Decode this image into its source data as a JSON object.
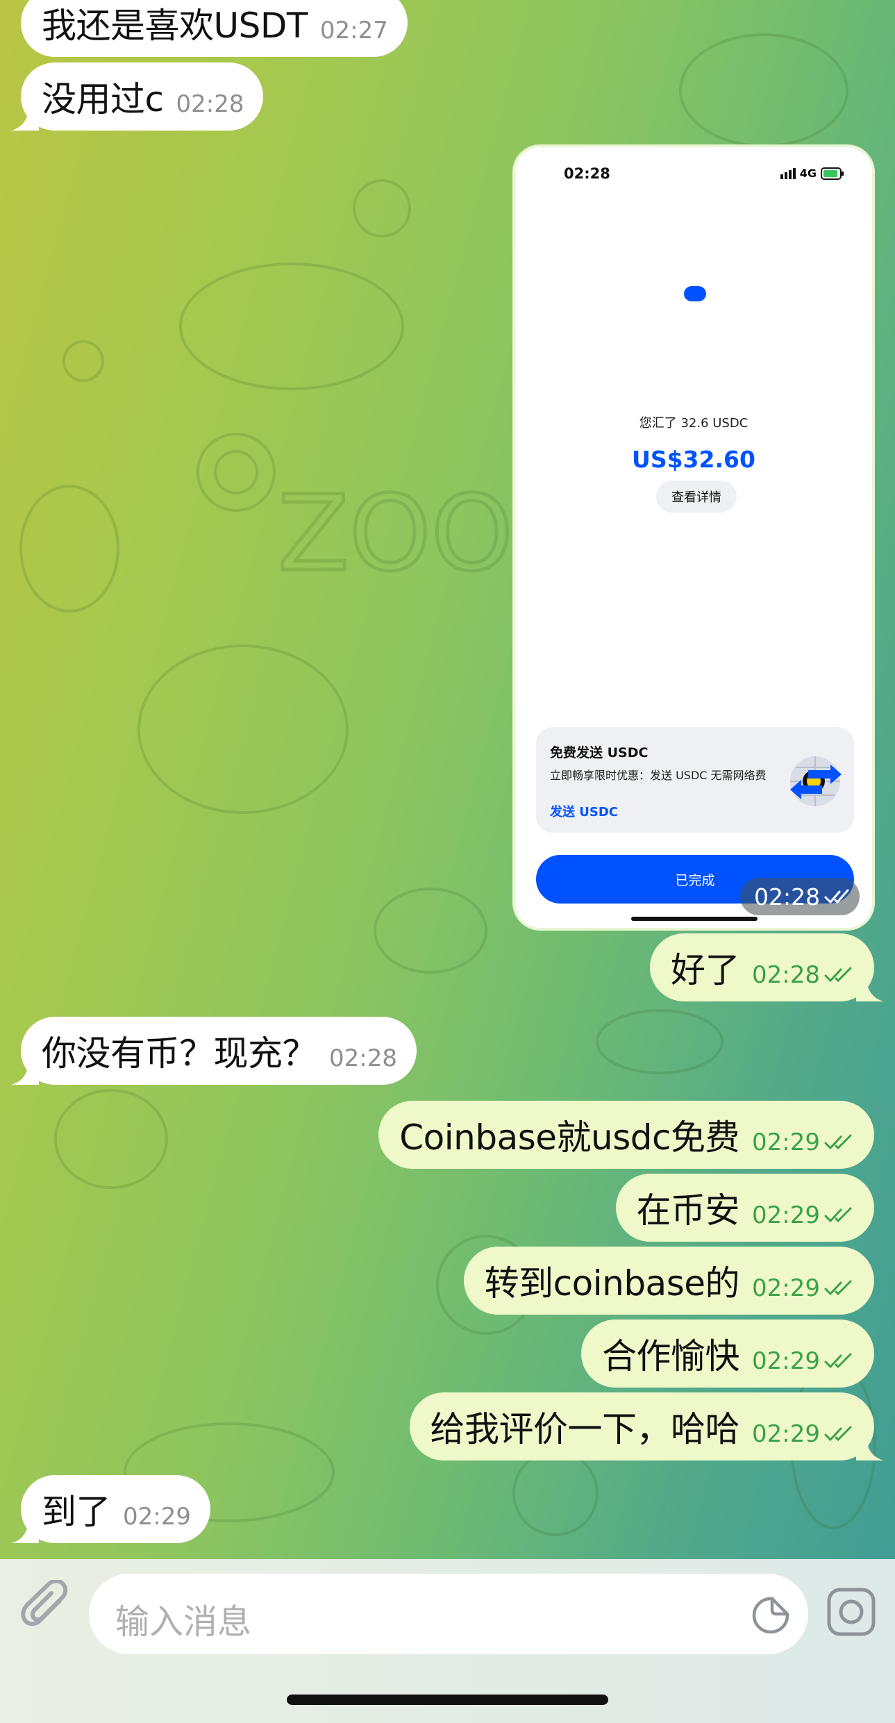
{
  "messages": [
    {
      "text": "我还是喜欢USDT",
      "time": "02:27",
      "dir": "in"
    },
    {
      "text": "没用过c",
      "time": "02:28",
      "dir": "in"
    },
    {
      "text": "好了",
      "time": "02:28",
      "dir": "out"
    },
    {
      "text": "你没有币？现充？",
      "time": "02:28",
      "dir": "in"
    },
    {
      "text": "Coinbase就usdc免费",
      "time": "02:29",
      "dir": "out"
    },
    {
      "text": "在币安",
      "time": "02:29",
      "dir": "out"
    },
    {
      "text": "转到coinbase的",
      "time": "02:29",
      "dir": "out"
    },
    {
      "text": "合作愉快",
      "time": "02:29",
      "dir": "out"
    },
    {
      "text": "给我评价一下，哈哈",
      "time": "02:29",
      "dir": "out"
    },
    {
      "text": "到了",
      "time": "02:29",
      "dir": "in"
    }
  ],
  "screenshot": {
    "time": "02:28",
    "status_time": "02:28",
    "network": "4G",
    "sent_line": "您汇了 32.6 USDC",
    "amount": "US$32.60",
    "details_button": "查看详情",
    "promo_title": "免费发送 USDC",
    "promo_desc": "立即畅享限时优惠：发送 USDC 无需网络费",
    "promo_link": "发送 USDC",
    "done_button": "已完成"
  },
  "input": {
    "placeholder": "输入消息"
  },
  "colors": {
    "brand_blue": "#0052ff",
    "outgoing_bubble": "#eef8c9",
    "incoming_bubble": "#ffffff",
    "time_green": "#3aa14a"
  },
  "icons": {
    "attach": "paperclip-icon",
    "sticker": "sticker-icon",
    "camera": "camera-icon",
    "read": "double-check-icon"
  }
}
